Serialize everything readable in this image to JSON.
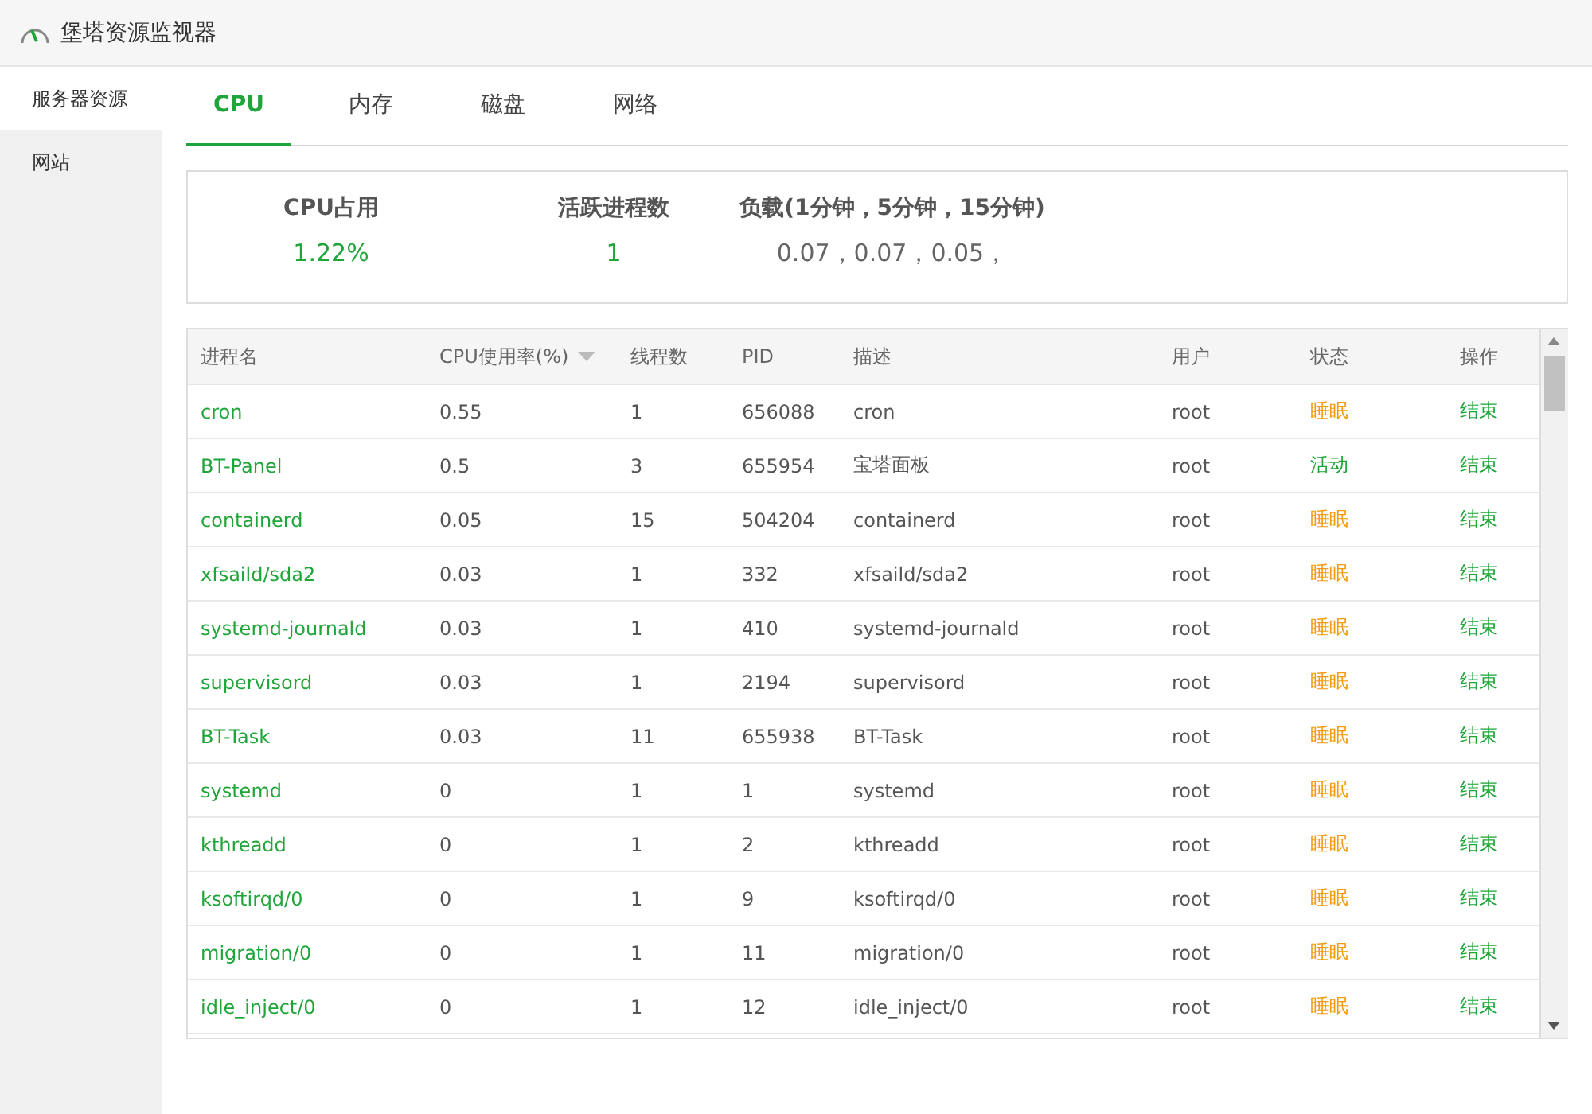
{
  "window": {
    "title": "堡塔资源监视器"
  },
  "sidebar": {
    "items": [
      {
        "label": "服务器资源",
        "selected": true
      },
      {
        "label": "网站",
        "selected": false
      }
    ]
  },
  "tabs": [
    {
      "label": "CPU",
      "selected": true
    },
    {
      "label": "内存",
      "selected": false
    },
    {
      "label": "磁盘",
      "selected": false
    },
    {
      "label": "网络",
      "selected": false
    }
  ],
  "summary": [
    {
      "label": "CPU占用",
      "value": "1.22%",
      "highlight": true
    },
    {
      "label": "活跃进程数",
      "value": "1",
      "highlight": true
    },
    {
      "label": "负载(1分钟，5分钟，15分钟)",
      "value": "0.07，0.07，0.05，",
      "highlight": false
    }
  ],
  "table": {
    "columns": [
      {
        "label": "进程名",
        "sorted": false
      },
      {
        "label": "CPU使用率(%)",
        "sorted": true
      },
      {
        "label": "线程数",
        "sorted": false
      },
      {
        "label": "PID",
        "sorted": false
      },
      {
        "label": "描述",
        "sorted": false
      },
      {
        "label": "用户",
        "sorted": false
      },
      {
        "label": "状态",
        "sorted": false
      },
      {
        "label": "操作",
        "sorted": false
      }
    ],
    "rows": [
      {
        "name": "cron",
        "cpu": "0.55",
        "threads": "1",
        "pid": "656088",
        "desc": "cron",
        "user": "root",
        "status": "睡眠",
        "color": "#f39c12",
        "action": "结束"
      },
      {
        "name": "BT-Panel",
        "cpu": "0.5",
        "threads": "3",
        "pid": "655954",
        "desc": "宝塔面板",
        "user": "root",
        "status": "活动",
        "color": "#20a53a",
        "action": "结束"
      },
      {
        "name": "containerd",
        "cpu": "0.05",
        "threads": "15",
        "pid": "504204",
        "desc": "containerd",
        "user": "root",
        "status": "睡眠",
        "color": "#f39c12",
        "action": "结束"
      },
      {
        "name": "xfsaild/sda2",
        "cpu": "0.03",
        "threads": "1",
        "pid": "332",
        "desc": "xfsaild/sda2",
        "user": "root",
        "status": "睡眠",
        "color": "#f39c12",
        "action": "结束"
      },
      {
        "name": "systemd-journald",
        "cpu": "0.03",
        "threads": "1",
        "pid": "410",
        "desc": "systemd-journald",
        "user": "root",
        "status": "睡眠",
        "color": "#f39c12",
        "action": "结束"
      },
      {
        "name": "supervisord",
        "cpu": "0.03",
        "threads": "1",
        "pid": "2194",
        "desc": "supervisord",
        "user": "root",
        "status": "睡眠",
        "color": "#f39c12",
        "action": "结束"
      },
      {
        "name": "BT-Task",
        "cpu": "0.03",
        "threads": "11",
        "pid": "655938",
        "desc": "BT-Task",
        "user": "root",
        "status": "睡眠",
        "color": "#f39c12",
        "action": "结束"
      },
      {
        "name": "systemd",
        "cpu": "0",
        "threads": "1",
        "pid": "1",
        "desc": "systemd",
        "user": "root",
        "status": "睡眠",
        "color": "#f39c12",
        "action": "结束"
      },
      {
        "name": "kthreadd",
        "cpu": "0",
        "threads": "1",
        "pid": "2",
        "desc": "kthreadd",
        "user": "root",
        "status": "睡眠",
        "color": "#f39c12",
        "action": "结束"
      },
      {
        "name": "ksoftirqd/0",
        "cpu": "0",
        "threads": "1",
        "pid": "9",
        "desc": "ksoftirqd/0",
        "user": "root",
        "status": "睡眠",
        "color": "#f39c12",
        "action": "结束"
      },
      {
        "name": "migration/0",
        "cpu": "0",
        "threads": "1",
        "pid": "11",
        "desc": "migration/0",
        "user": "root",
        "status": "睡眠",
        "color": "#f39c12",
        "action": "结束"
      },
      {
        "name": "idle_inject/0",
        "cpu": "0",
        "threads": "1",
        "pid": "12",
        "desc": "idle_inject/0",
        "user": "root",
        "status": "睡眠",
        "color": "#f39c12",
        "action": "结束"
      }
    ]
  }
}
